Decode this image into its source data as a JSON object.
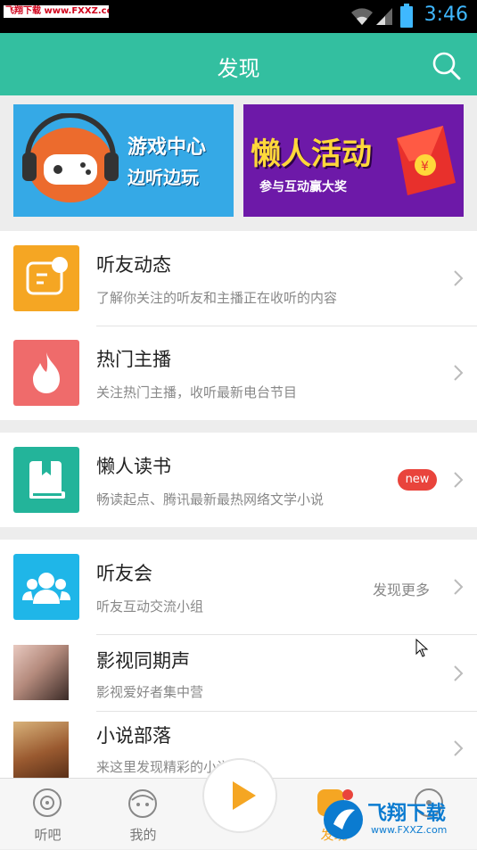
{
  "status_bar": {
    "watermark": "飞翔下载 www.FXXZ.com",
    "time": "3:46"
  },
  "header": {
    "title": "发现"
  },
  "banners": {
    "game": {
      "line1": "游戏中心",
      "line2": "边听边玩"
    },
    "activity": {
      "line1": "懒人活动",
      "line2": "参与互动赢大奖"
    }
  },
  "rows": [
    {
      "title": "听友动态",
      "subtitle": "了解你关注的听友和主播正在收听的内容",
      "icon": "friend-feed-icon",
      "color": "#f5a623"
    },
    {
      "title": "热门主播",
      "subtitle": "关注热门主播，收听最新电台节目",
      "icon": "flame-icon",
      "color": "#ef6b6b"
    },
    {
      "title": "懒人读书",
      "subtitle": "畅读起点、腾讯最新最热网络文学小说",
      "icon": "book-icon",
      "color": "#23b49a",
      "badge": "new"
    },
    {
      "title": "听友会",
      "subtitle": "听友互动交流小组",
      "icon": "group-icon",
      "color": "#1fb6e8",
      "extra": "发现更多"
    },
    {
      "title": "影视同期声",
      "subtitle": "影视爱好者集中营",
      "icon": "movie-thumbnail"
    },
    {
      "title": "小说部落",
      "subtitle": "来这里发现精彩的小说世界",
      "icon": "novel-thumbnail"
    }
  ],
  "bottom_nav": [
    {
      "label": "听吧",
      "icon": "record-icon"
    },
    {
      "label": "我的",
      "icon": "profile-icon"
    },
    {
      "label": "",
      "icon": "play-icon"
    },
    {
      "label": "发现",
      "icon": "discover-icon"
    },
    {
      "label": "",
      "icon": "more-icon"
    }
  ],
  "watermark_logo": {
    "text": "飞翔下载",
    "url": "www.FXXZ.com"
  },
  "colors": {
    "accent": "#33bfa0",
    "status_bar": "#000000",
    "badge": "#e9443c"
  }
}
